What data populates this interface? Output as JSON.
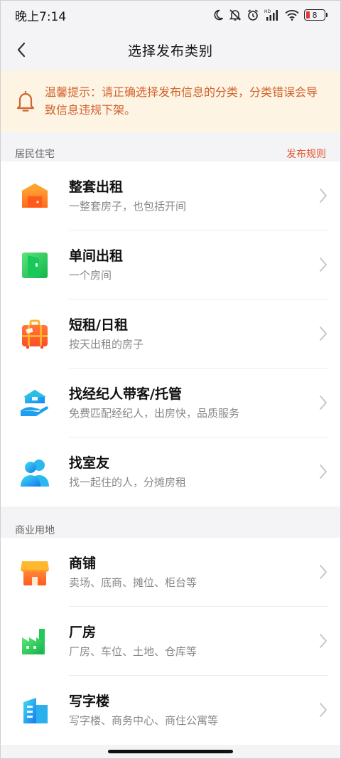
{
  "status": {
    "time": "晚上7:14",
    "battery_level": "8",
    "hd_label": "HD"
  },
  "nav": {
    "title": "选择发布类别"
  },
  "notice": {
    "text": "温馨提示：请正确选择发布信息的分类，分类错误会导致信息违规下架。"
  },
  "sections": [
    {
      "label": "居民住宅",
      "link": "发布规则",
      "items": [
        {
          "title": "整套出租",
          "subtitle": "一整套房子，也包括开间",
          "icon": "house-orange-icon"
        },
        {
          "title": "单间出租",
          "subtitle": "一个房间",
          "icon": "door-green-icon"
        },
        {
          "title": "短租/日租",
          "subtitle": "按天出租的房子",
          "icon": "suitcase-icon"
        },
        {
          "title": "找经纪人带客/托管",
          "subtitle": "免费匹配经纪人，出房快，品质服务",
          "icon": "hand-house-icon"
        },
        {
          "title": "找室友",
          "subtitle": "找一起住的人，分摊房租",
          "icon": "roommates-icon"
        }
      ]
    },
    {
      "label": "商业用地",
      "link": "",
      "items": [
        {
          "title": "商铺",
          "subtitle": "卖场、底商、摊位、柜台等",
          "icon": "shop-icon"
        },
        {
          "title": "厂房",
          "subtitle": "厂房、车位、土地、仓库等",
          "icon": "factory-icon"
        },
        {
          "title": "写字楼",
          "subtitle": "写字楼、商务中心、商住公寓等",
          "icon": "office-building-icon"
        }
      ]
    }
  ],
  "colors": {
    "accent": "#e4562e",
    "notice_bg": "#fdf4e4",
    "notice_text": "#d2632c"
  }
}
